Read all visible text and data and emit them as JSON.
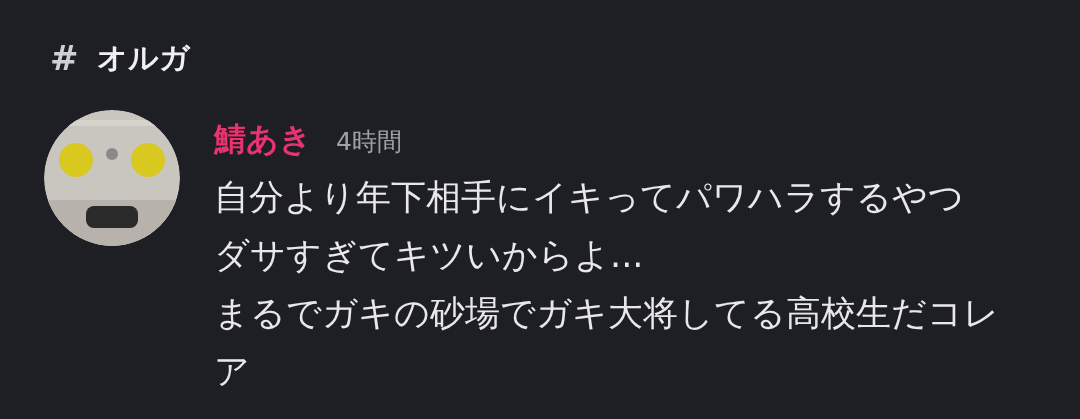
{
  "channel": {
    "icon": "#",
    "name": "オルガ"
  },
  "message": {
    "author": "鯖あき",
    "time": "4時間",
    "lines": [
      "自分より年下相手にイキってパワハラするやつ",
      "ダサすぎてキツいからよ...",
      "まるでガキの砂場でガキ大将してる高校生だコレア"
    ]
  }
}
